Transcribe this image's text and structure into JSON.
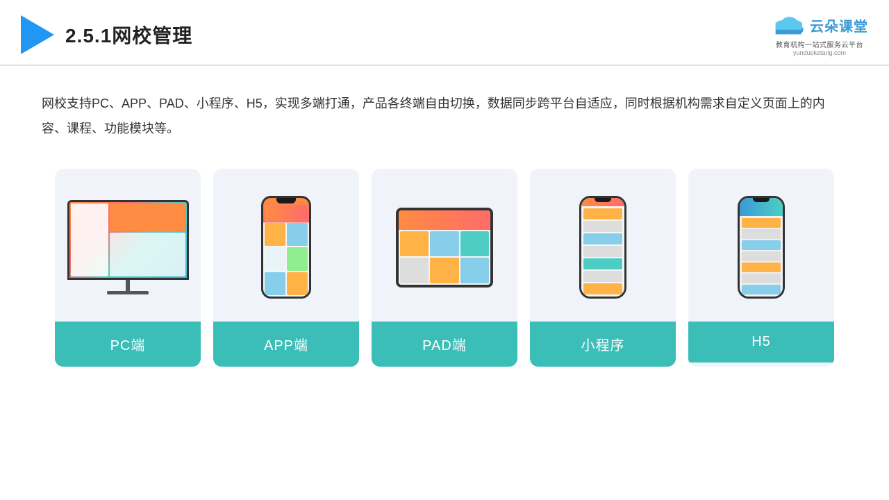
{
  "header": {
    "title": "2.5.1网校管理",
    "brand_name": "云朵课堂",
    "brand_url": "yunduoketang.com",
    "brand_tagline": "教育机构一站\n式服务云平台"
  },
  "description": "网校支持PC、APP、PAD、小程序、H5，实现多端打通，产品各终端自由切换，数据同步跨平台自适应，同时根据机构需求自定义页面上的内容、课程、功能模块等。",
  "cards": [
    {
      "id": "pc",
      "label": "PC端"
    },
    {
      "id": "app",
      "label": "APP端"
    },
    {
      "id": "pad",
      "label": "PAD端"
    },
    {
      "id": "miniprogram",
      "label": "小程序"
    },
    {
      "id": "h5",
      "label": "H5"
    }
  ]
}
